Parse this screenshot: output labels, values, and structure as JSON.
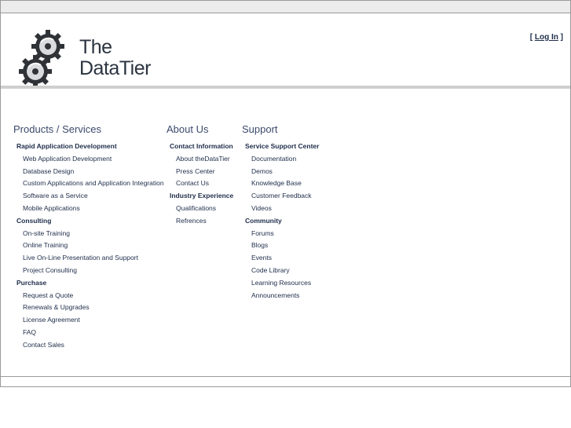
{
  "brand": {
    "line1": "The",
    "line2": "DataTier"
  },
  "login": {
    "open": "[",
    "label": "Log In",
    "close": "]"
  },
  "columns": [
    {
      "title": "Products / Services",
      "groups": [
        {
          "label": "Rapid Application Development",
          "items": [
            "Web Application Development",
            "Database Design",
            "Custom Applications and Application Integration",
            "Software as a Service",
            "Mobile Applications"
          ]
        },
        {
          "label": "Consulting",
          "items": [
            "On-site Training",
            "Online Training",
            "Live On-Line Presentation and Support",
            "Project Consulting"
          ]
        },
        {
          "label": "Purchase",
          "items": [
            "Request a Quote",
            "Renewals & Upgrades",
            "License Agreement",
            "FAQ",
            "Contact Sales"
          ]
        }
      ]
    },
    {
      "title": "About Us",
      "groups": [
        {
          "label": "Contact Information",
          "items": [
            "About theDataTier",
            "Press Center",
            "Contact Us"
          ]
        },
        {
          "label": "Industry Experience",
          "items": [
            "Qualifications",
            "Refrences"
          ]
        }
      ]
    },
    {
      "title": "Support",
      "groups": [
        {
          "label": "Service Support Center",
          "items": [
            "Documentation",
            "Demos",
            "Knowledge Base",
            "Customer Feedback",
            "Videos"
          ]
        },
        {
          "label": "Community",
          "items": [
            "Forums",
            "Blogs",
            "Events",
            "Code Library",
            "Learning Resources",
            "Announcements"
          ]
        }
      ]
    }
  ]
}
